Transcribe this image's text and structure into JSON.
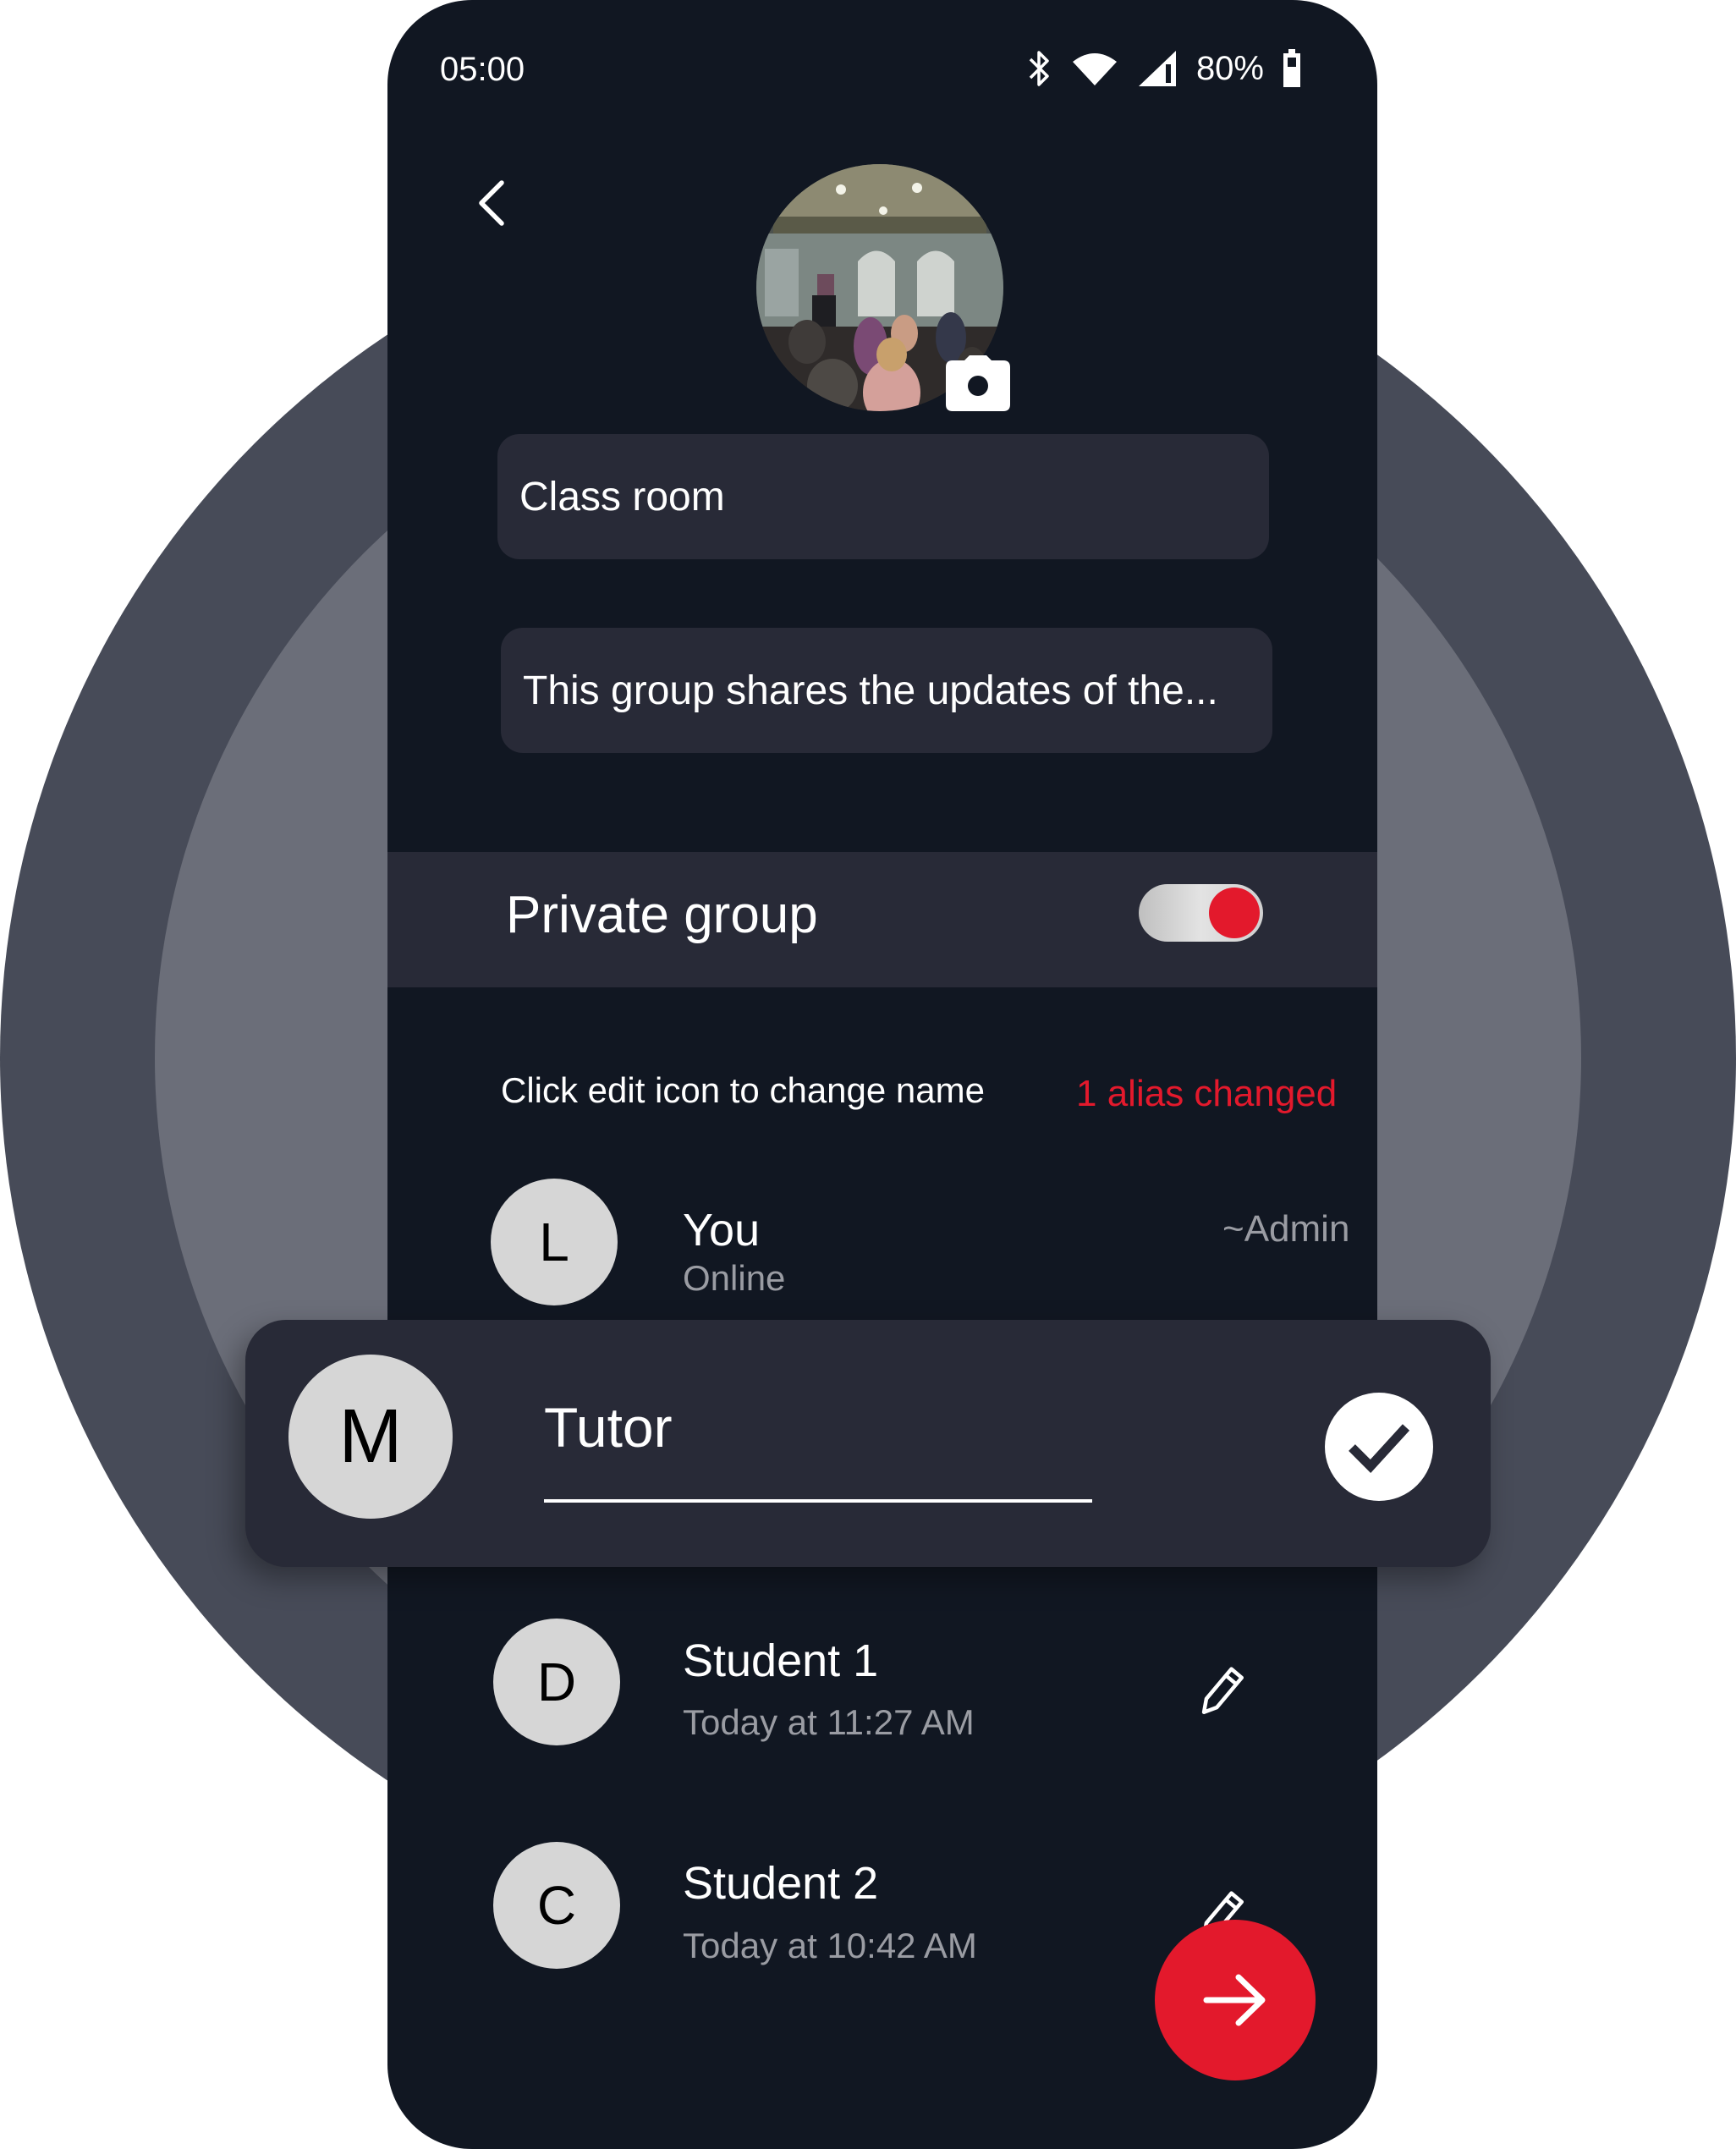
{
  "status_bar": {
    "time": "05:00",
    "battery_percent": "80%",
    "icons": [
      "bluetooth-icon",
      "wifi-icon",
      "signal-icon",
      "battery-icon"
    ]
  },
  "header": {
    "back_icon": "chevron-left-icon",
    "group_avatar_alt": "Classroom group photo",
    "camera_icon": "camera-icon"
  },
  "group": {
    "name_value": "Class room",
    "description_value": "This group shares the updates of the..."
  },
  "privacy": {
    "label": "Private group",
    "toggle_on": true,
    "accent_color": "#e3192c"
  },
  "members_section": {
    "hint": "Click edit icon to change name",
    "alias_status": "1 alias changed"
  },
  "members": [
    {
      "initial": "L",
      "name": "You",
      "subtitle": "Online",
      "role": "~Admin"
    },
    {
      "initial": "D",
      "name": "Student 1",
      "subtitle": "Today at 11:27 AM",
      "action_icon": "pencil-icon"
    },
    {
      "initial": "C",
      "name": "Student 2",
      "subtitle": "Today at 10:42 AM",
      "action_icon": "pencil-icon"
    }
  ],
  "alias_editor": {
    "initial": "M",
    "value": "Tutor",
    "confirm_icon": "check-icon"
  },
  "fab": {
    "icon": "arrow-right-icon"
  },
  "colors": {
    "phone_bg": "#111722",
    "card_bg": "#282a37",
    "accent": "#e3192c",
    "outer_circle": "#474b58",
    "inner_circle": "#6b6e79"
  }
}
